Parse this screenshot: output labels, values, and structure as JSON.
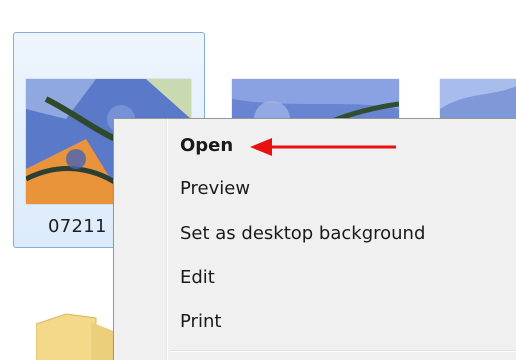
{
  "file": {
    "name_visible": "07211"
  },
  "context_menu": {
    "items": [
      {
        "label": "Open",
        "default": true
      },
      {
        "label": "Preview"
      },
      {
        "label": "Set as desktop background"
      },
      {
        "label": "Edit"
      },
      {
        "label": "Print"
      }
    ]
  },
  "colors": {
    "selection_border": "#84acdd",
    "selection_fill": "#dcebfc",
    "menu_background": "#f0f0f0",
    "annotation_arrow": "#e81010"
  },
  "icons": {
    "annotation": "arrow-left-icon",
    "folder": "folder-icon"
  }
}
